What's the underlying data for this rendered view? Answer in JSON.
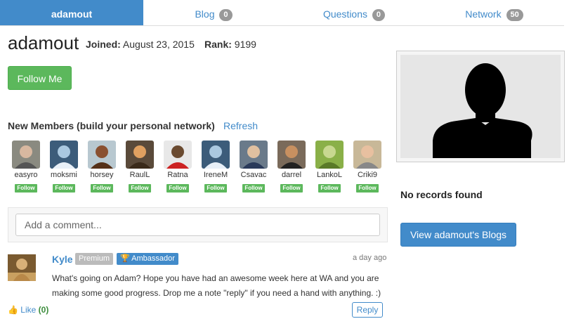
{
  "tabs": [
    {
      "label": "adamout",
      "badge": null,
      "active": true
    },
    {
      "label": "Blog",
      "badge": "0",
      "active": false
    },
    {
      "label": "Questions",
      "badge": "0",
      "active": false
    },
    {
      "label": "Network",
      "badge": "50",
      "active": false
    }
  ],
  "profile": {
    "username": "adamout",
    "joined_label": "Joined:",
    "joined_value": "August 23, 2015",
    "rank_label": "Rank:",
    "rank_value": "9199",
    "follow_button": "Follow Me"
  },
  "new_members": {
    "title": "New Members (build your personal network)",
    "refresh": "Refresh",
    "follow_label": "Follow",
    "members": [
      {
        "name": "easyro"
      },
      {
        "name": "moksmi"
      },
      {
        "name": "horsey"
      },
      {
        "name": "RaulL"
      },
      {
        "name": "Ratna"
      },
      {
        "name": "IreneM"
      },
      {
        "name": "Csavac"
      },
      {
        "name": "darrel"
      },
      {
        "name": "LankoL"
      },
      {
        "name": "Criki9"
      }
    ]
  },
  "comment_input": {
    "placeholder": "Add a comment..."
  },
  "comment": {
    "author": "Kyle",
    "badge_premium": "Premium",
    "badge_ambassador": "Ambassador",
    "time": "a day ago",
    "text": "What's going on Adam? Hope you have had an awesome week here at WA and you are making some good progress. Drop me a note \"reply\" if you need a hand with anything. :)",
    "like_label": "Like",
    "like_count": "(0)",
    "reply_button": "Reply"
  },
  "sidebar": {
    "no_records": "No records found",
    "blogs_button": "View adamout's Blogs"
  }
}
